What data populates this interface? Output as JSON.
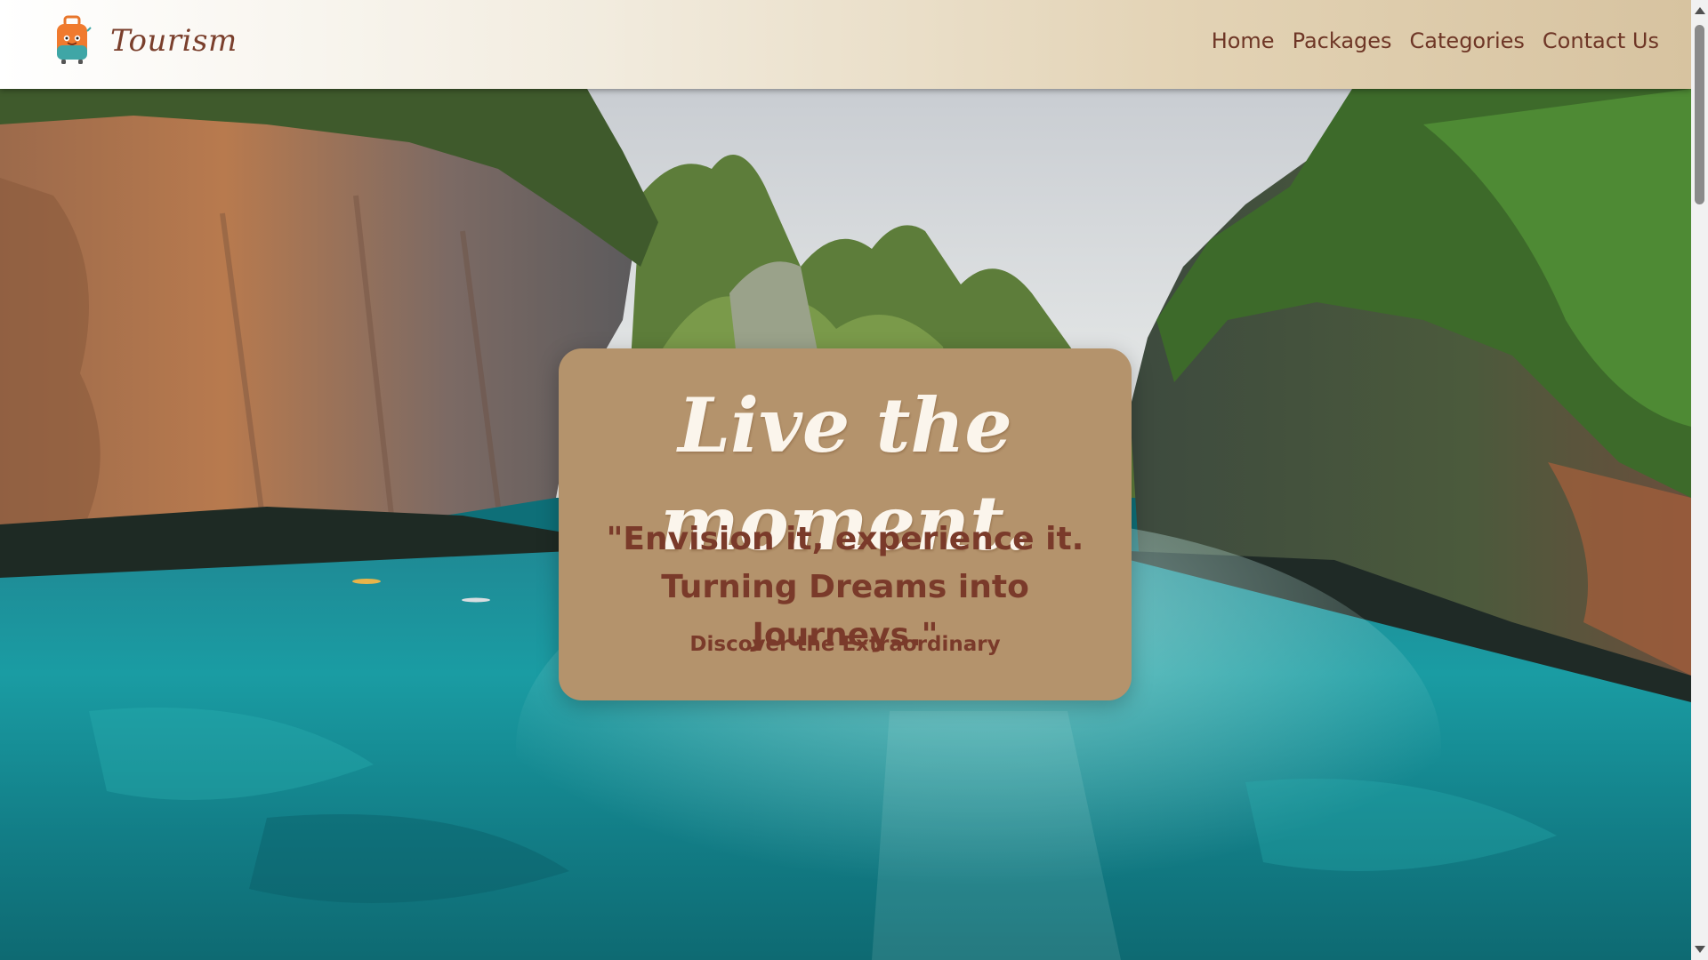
{
  "brand": {
    "name": "Tourism",
    "logo_icon": "suitcase-icon"
  },
  "nav": {
    "items": [
      {
        "label": "Home"
      },
      {
        "label": "Packages"
      },
      {
        "label": "Categories"
      },
      {
        "label": "Contact Us"
      }
    ]
  },
  "hero": {
    "background": "tropical-lagoon-cliffs-image",
    "title": "Live the moment.",
    "quote_line1": "\"Envision it, experience it.",
    "quote_line2": "Turning Dreams into Journeys.\"",
    "subtitle": "Discover the Extraordinary"
  },
  "colors": {
    "card_bg": "#b4936c",
    "text_brown": "#7a3a2a",
    "nav_text": "#6e3626",
    "title_text": "#fbf5ec"
  }
}
